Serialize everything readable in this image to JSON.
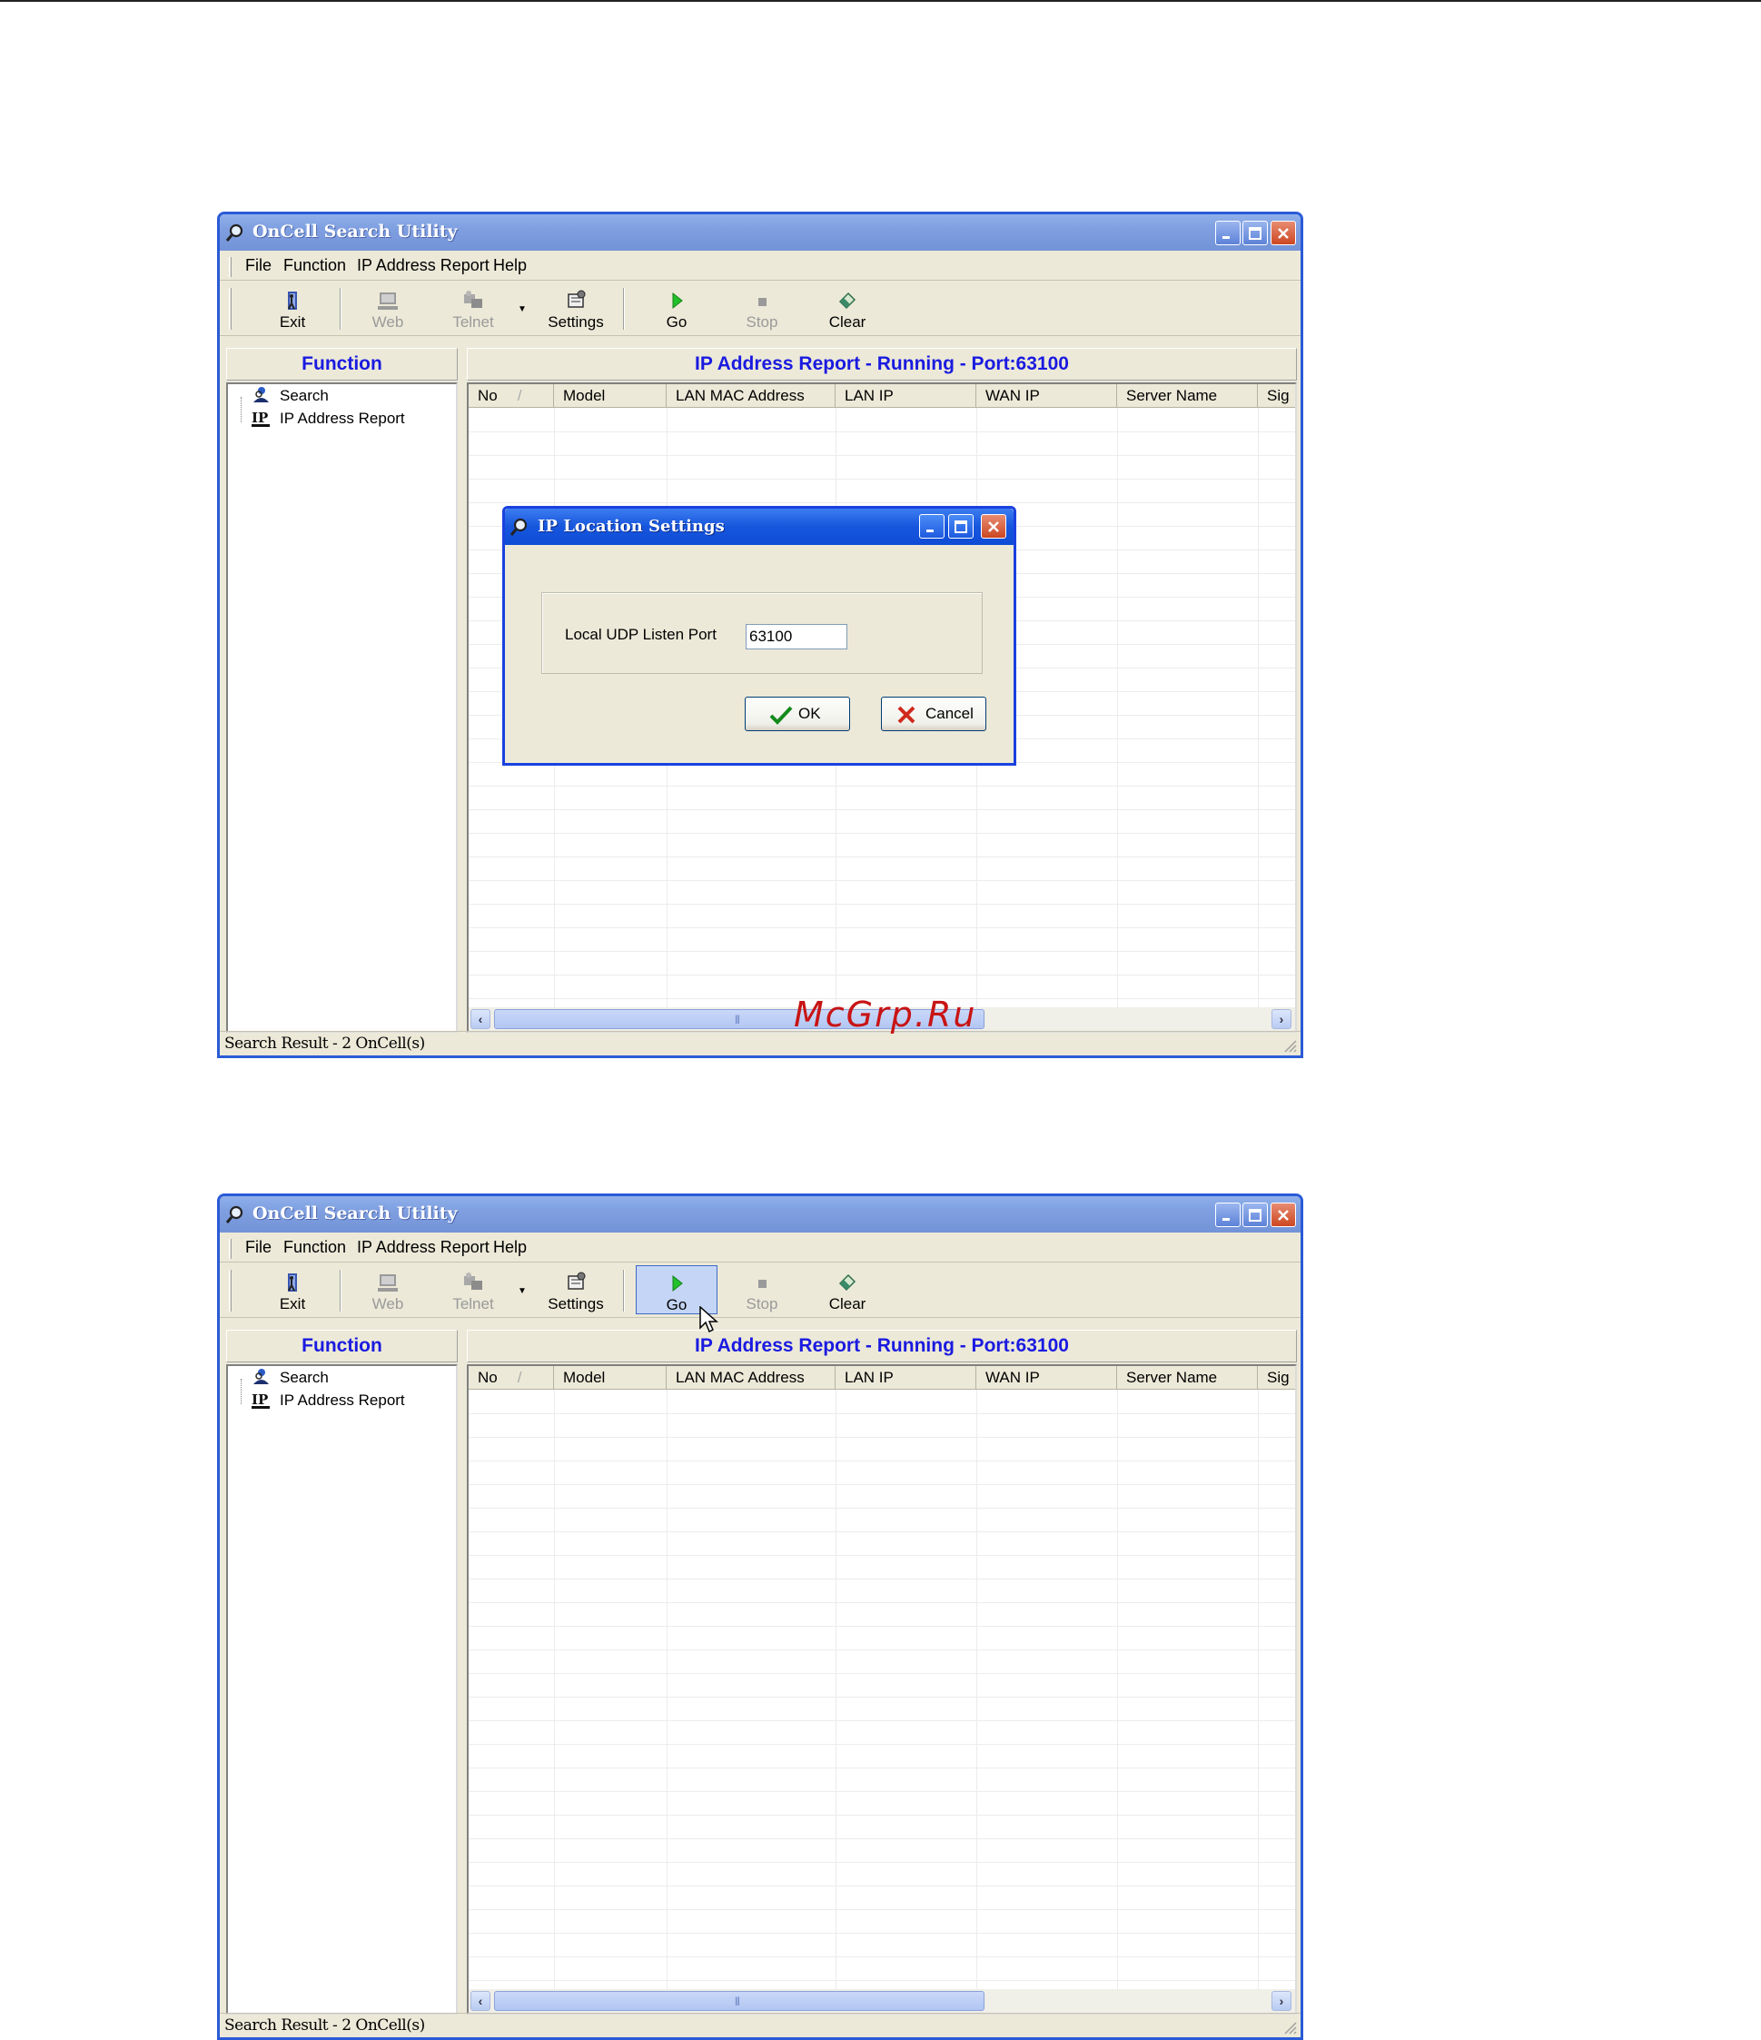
{
  "app": {
    "title": "OnCell Search Utility"
  },
  "menu": {
    "file": "File",
    "function": "Function",
    "ip_report": "IP Address Report",
    "help": "Help"
  },
  "toolbar": {
    "exit": "Exit",
    "web": "Web",
    "telnet": "Telnet",
    "settings": "Settings",
    "go": "Go",
    "stop": "Stop",
    "clear": "Clear"
  },
  "left_panel": {
    "header": "Function",
    "items": [
      "Search",
      "IP Address Report"
    ]
  },
  "report": {
    "header": "IP Address Report - Running - Port:63100",
    "columns": [
      "No",
      "Model",
      "LAN MAC Address",
      "LAN IP",
      "WAN IP",
      "Server Name",
      "Sig"
    ]
  },
  "status": {
    "text": "Search Result - 2 OnCell(s)"
  },
  "dialog": {
    "title": "IP Location Settings",
    "port_label": "Local UDP Listen Port",
    "port_value": "63100",
    "ok": "OK",
    "cancel": "Cancel"
  },
  "watermark": "McGrp.Ru",
  "icons": [
    "search-magnifier-icon",
    "exit-icon",
    "web-icon",
    "telnet-icon",
    "settings-icon",
    "go-play-icon",
    "stop-icon",
    "clear-eraser-icon",
    "minimize-icon",
    "maximize-icon",
    "close-icon",
    "checkmark-icon",
    "x-icon",
    "mouse-cursor-icon"
  ]
}
